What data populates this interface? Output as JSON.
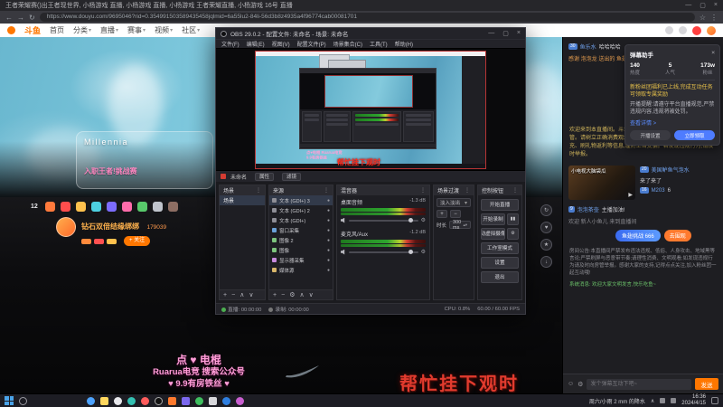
{
  "colors": {
    "douyu_orange": "#ff7700",
    "accent_blue": "#4e7cff",
    "overlay_red": "#e23b2e",
    "overlay_pink": "#ff9ed8",
    "meter_green": "#2ea52e",
    "meter_red": "#d43c32"
  },
  "win": {
    "min": "—",
    "max": "▢",
    "close": "×"
  },
  "browser": {
    "tab_title": "王者荣耀赛()出王者现世界, 小杨游戏 直播, 小杨游戏 直播, 小杨游戏 王者荣耀直播, 小杨游戏 16号 直播",
    "url": "https://www.douyu.com/9695046?rid=0.354991503589435458jqlmid=6a55lu2-84li-56d3b8z4935a4f96774cab00081701",
    "back": "←",
    "forward": "→",
    "reload": "↻",
    "star": "☆",
    "menu": "⋮"
  },
  "nav": {
    "logo_text": "斗鱼",
    "caret": "▾",
    "items": [
      "首页",
      "分类",
      "直播",
      "赛事",
      "视频",
      "社区"
    ]
  },
  "banner": {
    "game_title": "Millennia",
    "promo": "入职王者!挑战赛"
  },
  "streamer": {
    "count": "12",
    "name": "钻石双倍结缘绑绑",
    "room_id": "179039",
    "follow": "+ 关注"
  },
  "side_fabs": [
    "↻",
    "♥",
    "★",
    "↓"
  ],
  "overlay": {
    "pink1": "点 ♥ 电棍",
    "pink2": "Ruarua电竞 搜索公众号",
    "pink3": "♥ 9.9有房铁丝 ♥",
    "red": "帮忙挂下观时"
  },
  "obs": {
    "title": "OBS 29.0.2 - 配置文件: 未命名 - 场景: 未命名",
    "menus": [
      "文件(F)",
      "编辑(E)",
      "视图(V)",
      "配置文件(P)",
      "场景集合(C)",
      "工具(T)",
      "帮助(H)"
    ],
    "preview": {
      "pink1": "点♥电棍 Ruarua电竞",
      "pink2": "9.9有房铁丝",
      "red": "帮忙挂下观时"
    },
    "scenebar": {
      "label": "未命名",
      "props": "属性",
      "filters": "滤镜"
    },
    "dock_tools": {
      "add": "+",
      "remove": "−",
      "up": "∧",
      "down": "∨",
      "gear": "⚙",
      "dots": "⋮",
      "eye": "●",
      "caret": "▾",
      "spin": "▴▾",
      "pause": "▮▮"
    },
    "scenes": {
      "title": "场景",
      "item": "场景"
    },
    "sources": {
      "title": "来源",
      "items": [
        "文本 (GDI+) 3",
        "文本 (GDI+) 2",
        "文本 (GDI+)",
        "窗口采集",
        "图像 2",
        "图像",
        "显示器采集",
        "媒体源"
      ]
    },
    "mixer": {
      "title": "混音器",
      "channels": [
        {
          "name": "桌面音频",
          "db": "-1.3 dB"
        },
        {
          "name": "麦克风/Aux",
          "db": "-1.2 dB"
        }
      ]
    },
    "transitions": {
      "title": "场景过渡",
      "value": "淡入淡出",
      "duration_label": "时长",
      "duration": "300 ms"
    },
    "controls": {
      "title": "控制按钮",
      "buttons": [
        "开始直播",
        "开始录制",
        "启动虚拟摄像机",
        "工作室模式",
        "设置",
        "退出"
      ]
    },
    "status": {
      "live": "直播: 00:00:00",
      "rec": "录制: 00:00:00",
      "cpu": "CPU: 0.8%",
      "fps": "60.00 / 60.00 FPS"
    }
  },
  "helper": {
    "title": "弹幕助手",
    "close": "×",
    "stats": [
      {
        "label": "热度",
        "value": "140"
      },
      {
        "label": "人气",
        "value": "5"
      },
      {
        "label": "粉丝",
        "value": "173w"
      }
    ],
    "notice": "新粉丝团福利已上线,完成互动任务可领取专属奖励",
    "body": "开播提醒:请遵守平台直播规范,严禁违规内容,违规将被处罚。",
    "link": "查看详情 >",
    "btn1": "开播设置",
    "btn2": "立即领取"
  },
  "chat": {
    "announcement": "欢迎来到本直播间。斗鱼严禁未成年人进行充值打赏或担任房管。请树立正确消费观念,理性消费;请勿轻信平台内外的代充、刷礼物返利等信息,谨防上当受骗。若发现违规行为,请及时举报。",
    "gift_line": "感谢 泡泡龙 送出的 鱼翅 ×66",
    "enter_line": "欢迎 新人小鱼儿 来到直播间",
    "video_caption": "小电视大脑袋瓜",
    "play_icon": "▶",
    "messages": [
      {
        "level": "30",
        "name": "鱼乐水",
        "text": "哈哈哈哈"
      },
      {
        "level": "20",
        "name": "美国鲈鱼气泡水",
        "text": "来了来了"
      },
      {
        "level": "16",
        "name": "M203",
        "text": "6"
      },
      {
        "level": "9",
        "name": "泡泡茶壶",
        "text": "主播加油!"
      }
    ],
    "vote_label": "鱼翅挑战 666",
    "vote_action": "去围观",
    "rules": "房间公告:本直播间严禁发布违法违规、低俗、人身攻击、地域黑等言论;严禁刷屏与恶意带节奏;请理性消费、文明观看;如发现违规行为请及时向房管举报。感谢大家的支持,记得点点关注,加入粉丝团一起互动哦!",
    "system_green": "系统消息: 欢迎大家文明发言,快乐吃鱼~",
    "emoji_icon": "☺",
    "gear_icon": "⚙",
    "input_placeholder": "发个弹幕互动下吧~",
    "send": "发送"
  },
  "taskbar": {
    "weather": "周六/小雨 2 mm 的降水",
    "tray_arrow": "∧",
    "time": "16:36",
    "date": "2024/4/15"
  }
}
